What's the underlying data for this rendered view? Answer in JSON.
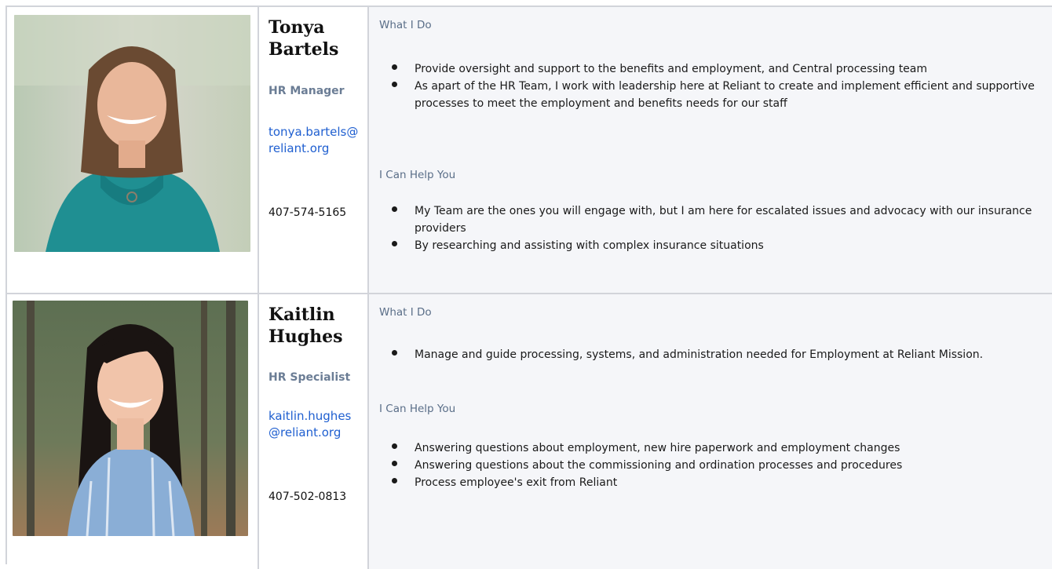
{
  "colors": {
    "border": "#d2d4da",
    "desc_background": "#f5f6f9",
    "heading": "#5a6e88",
    "job_title": "#6b7d95",
    "link": "#1f5fd0"
  },
  "people": [
    {
      "name_line1": "Tonya",
      "name_line2": "Bartels",
      "title": "HR Manager",
      "email": "tonya.bartels@reliant.org",
      "phone": "407-574-5165",
      "what_heading": "What I Do",
      "what_items": [
        "Provide oversight and support to the benefits and employment, and Central processing team",
        "As apart of the HR Team, I work with leadership here at Reliant to create and implement efficient and supportive processes to meet the employment and benefits needs for our staff"
      ],
      "help_heading": "I Can Help You",
      "help_items": [
        "My Team are the ones you will engage with, but I am here for escalated issues and advocacy with our insurance providers",
        "By researching and assisting with complex insurance situations"
      ]
    },
    {
      "name_line1": "Kaitlin",
      "name_line2": "Hughes",
      "title": "HR Specialist",
      "email": "kaitlin.hughes@reliant.org",
      "phone": "407-502-0813",
      "what_heading": "What I Do",
      "what_items": [
        "Manage and guide processing, systems, and administration needed for Employment at Reliant Mission."
      ],
      "help_heading": "I Can Help You",
      "help_items": [
        "Answering questions about employment, new hire paperwork and employment changes",
        "Answering questions about the commissioning and ordination processes and procedures",
        "Process employee's exit from Reliant"
      ]
    }
  ]
}
